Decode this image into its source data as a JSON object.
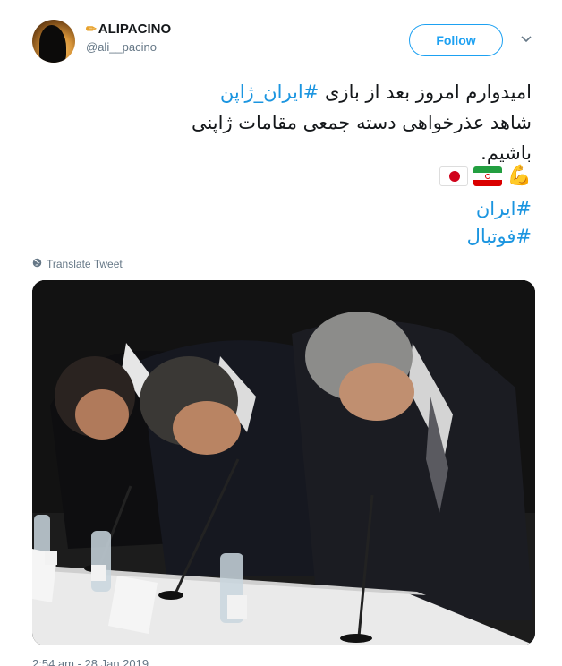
{
  "tweet": {
    "display_name": "ALIPACINO",
    "handle": "@ali__pacino",
    "follow_label": "Follow",
    "text_line1_prefix": "امیدوارم امروز بعد از بازی ",
    "text_line1_hashtag": "#ایران_ژاپن",
    "text_line2": "شاهد عذرخواهی دسته جمعی مقامات ژاپنی",
    "text_line3": "باشیم.",
    "hashtag1": "#ایران",
    "hashtag2": "#فوتبال",
    "translate_label": "Translate Tweet",
    "timestamp": "2:54 am - 28 Jan 2019"
  },
  "icons": {
    "name_prefix": "pencil-icon",
    "menu": "chevron-down-icon",
    "translate": "globe-icon",
    "emoji": [
      "muscle-icon",
      "iran-flag-icon",
      "japan-flag-icon"
    ]
  },
  "colors": {
    "accent": "#1da1f2",
    "hashtag": "#1b95e0",
    "text": "#14171a",
    "secondary": "#657786"
  }
}
